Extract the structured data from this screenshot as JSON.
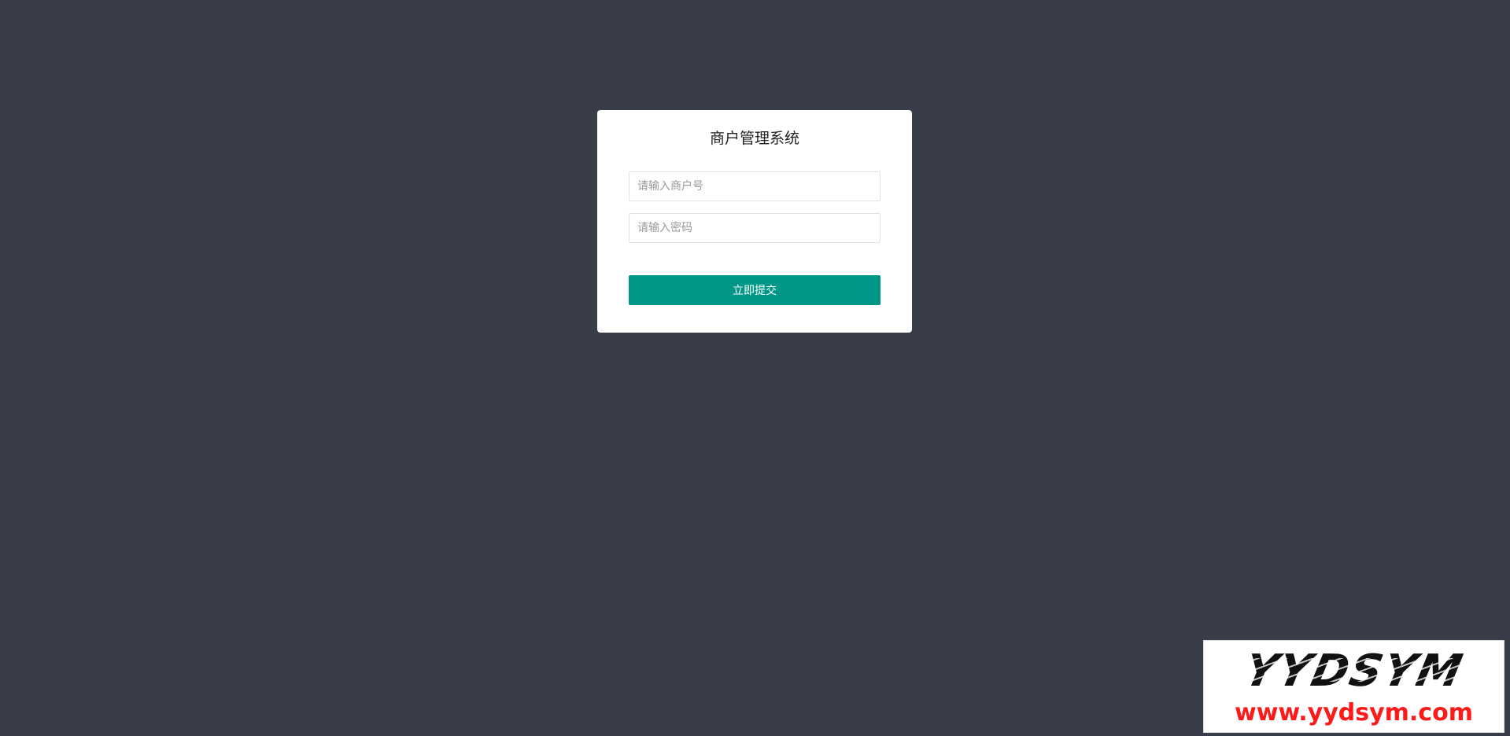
{
  "colors": {
    "background": "#393d49",
    "card": "#ffffff",
    "accent": "#009688",
    "watermark_url": "#ff1a1a"
  },
  "login": {
    "title": "商户管理系统",
    "merchant_input": {
      "value": "",
      "placeholder": "请输入商户号"
    },
    "password_input": {
      "value": "",
      "placeholder": "请输入密码"
    },
    "submit_label": "立即提交"
  },
  "watermark": {
    "brand": "YYDSYM",
    "url": "www.yydsym.com"
  }
}
